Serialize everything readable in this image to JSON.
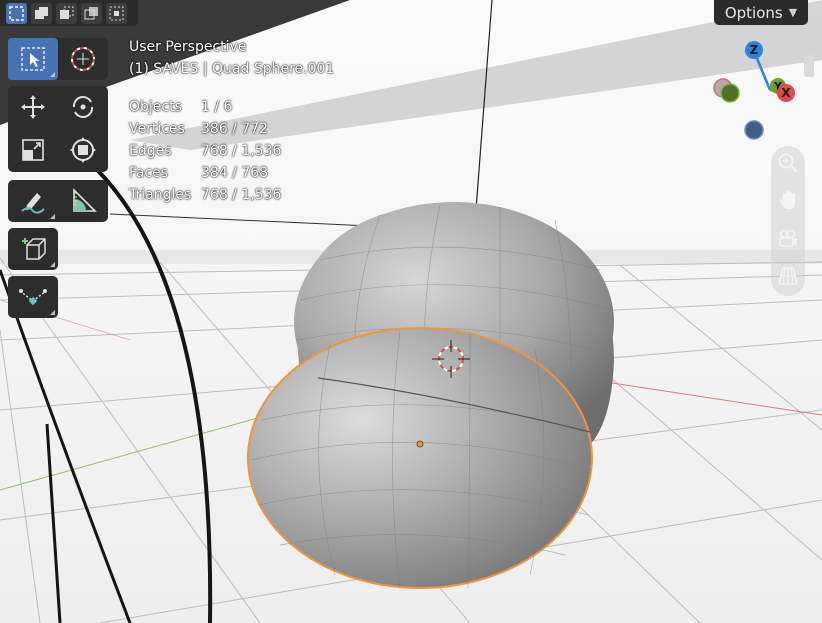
{
  "header": {
    "options_label": "Options"
  },
  "viewport": {
    "perspective_label": "User Perspective",
    "object_info": "(1) SAVES | Quad Sphere.001"
  },
  "stats": [
    {
      "label": "Objects",
      "value": "1 / 6"
    },
    {
      "label": "Vertices",
      "value": "386 / 772"
    },
    {
      "label": "Edges",
      "value": "768 / 1,536"
    },
    {
      "label": "Faces",
      "value": "384 / 768"
    },
    {
      "label": "Triangles",
      "value": "768 / 1,536"
    }
  ],
  "gizmo": {
    "axes": {
      "z": "Z",
      "x": "X",
      "y": "Y"
    },
    "colors": {
      "x": "#e8454d",
      "y": "#6fa02e",
      "z": "#2f83d8"
    }
  },
  "selection_modes": [
    "select-new-icon",
    "extend-icon",
    "subtract-icon",
    "invert-icon",
    "intersect-icon"
  ],
  "tools": [
    "select-box-icon",
    "cursor-icon",
    "move-icon",
    "rotate-icon",
    "scale-icon",
    "transform-icon",
    "annotate-icon",
    "measure-icon",
    "add-cube-icon",
    "shear-icon"
  ],
  "nav_tools": [
    "zoom-icon",
    "hand-pan-icon",
    "camera-icon",
    "grid-ortho-icon"
  ],
  "colors": {
    "accent": "#4772b3",
    "selection_outline": "#f0963a",
    "panel": "#2d2d2d"
  }
}
